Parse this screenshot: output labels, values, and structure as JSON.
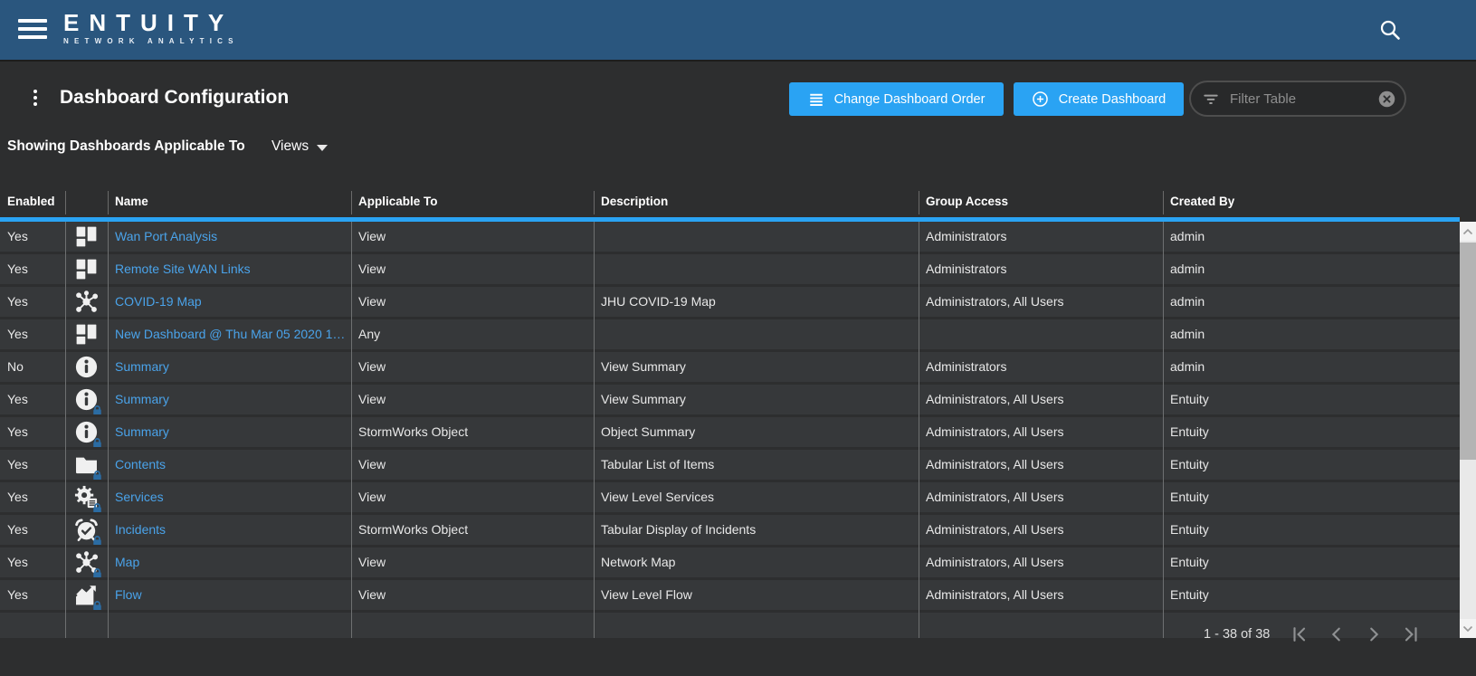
{
  "navbar": {
    "logo_title": "ENTUITY",
    "logo_subtitle": "NETWORK ANALYTICS"
  },
  "header": {
    "title": "Dashboard Configuration",
    "change_order_label": "Change Dashboard Order",
    "create_label": "Create Dashboard",
    "filter_placeholder": "Filter Table"
  },
  "filter_bar": {
    "label": "Showing Dashboards Applicable To",
    "selected": "Views"
  },
  "table": {
    "columns": [
      "Enabled",
      "",
      "Name",
      "Applicable To",
      "Description",
      "Group Access",
      "Created By"
    ],
    "rows": [
      {
        "enabled": "Yes",
        "icon": "dashboard-icon",
        "lock": false,
        "name": "Wan Port Analysis",
        "applicable_to": "View",
        "description": "",
        "group_access": "Administrators",
        "created_by": "admin"
      },
      {
        "enabled": "Yes",
        "icon": "dashboard-icon",
        "lock": false,
        "name": "Remote Site WAN Links",
        "applicable_to": "View",
        "description": "",
        "group_access": "Administrators",
        "created_by": "admin"
      },
      {
        "enabled": "Yes",
        "icon": "map-icon",
        "lock": false,
        "name": "COVID-19 Map",
        "applicable_to": "View",
        "description": "JHU COVID-19 Map",
        "group_access": "Administrators, All Users",
        "created_by": "admin"
      },
      {
        "enabled": "Yes",
        "icon": "dashboard-icon",
        "lock": false,
        "name": "New Dashboard @ Thu Mar 05 2020 1…",
        "applicable_to": "Any",
        "description": "",
        "group_access": "",
        "created_by": "admin"
      },
      {
        "enabled": "No",
        "icon": "info-icon",
        "lock": false,
        "name": "Summary",
        "applicable_to": "View",
        "description": "View Summary",
        "group_access": "Administrators",
        "created_by": "admin"
      },
      {
        "enabled": "Yes",
        "icon": "info-icon",
        "lock": true,
        "name": "Summary",
        "applicable_to": "View",
        "description": "View Summary",
        "group_access": "Administrators, All Users",
        "created_by": "Entuity"
      },
      {
        "enabled": "Yes",
        "icon": "info-icon",
        "lock": true,
        "name": "Summary",
        "applicable_to": "StormWorks Object",
        "description": "Object Summary",
        "group_access": "Administrators, All Users",
        "created_by": "Entuity"
      },
      {
        "enabled": "Yes",
        "icon": "folder-icon",
        "lock": true,
        "name": "Contents",
        "applicable_to": "View",
        "description": "Tabular List of Items",
        "group_access": "Administrators, All Users",
        "created_by": "Entuity"
      },
      {
        "enabled": "Yes",
        "icon": "services-icon",
        "lock": true,
        "name": "Services",
        "applicable_to": "View",
        "description": "View Level Services",
        "group_access": "Administrators, All Users",
        "created_by": "Entuity"
      },
      {
        "enabled": "Yes",
        "icon": "incidents-icon",
        "lock": true,
        "name": "Incidents",
        "applicable_to": "StormWorks Object",
        "description": "Tabular Display of Incidents",
        "group_access": "Administrators, All Users",
        "created_by": "Entuity"
      },
      {
        "enabled": "Yes",
        "icon": "map-icon",
        "lock": true,
        "name": "Map",
        "applicable_to": "View",
        "description": "Network Map",
        "group_access": "Administrators, All Users",
        "created_by": "Entuity"
      },
      {
        "enabled": "Yes",
        "icon": "flow-icon",
        "lock": true,
        "name": "Flow",
        "applicable_to": "View",
        "description": "View Level Flow",
        "group_access": "Administrators, All Users",
        "created_by": "Entuity"
      }
    ]
  },
  "pagination": {
    "range_label": "1 - 38 of 38"
  },
  "colors": {
    "navbar_blue": "#2a567e",
    "accent_blue": "#2aa3f3",
    "link_blue": "#4aa3ea",
    "lock_blue": "#2b6ca3"
  }
}
